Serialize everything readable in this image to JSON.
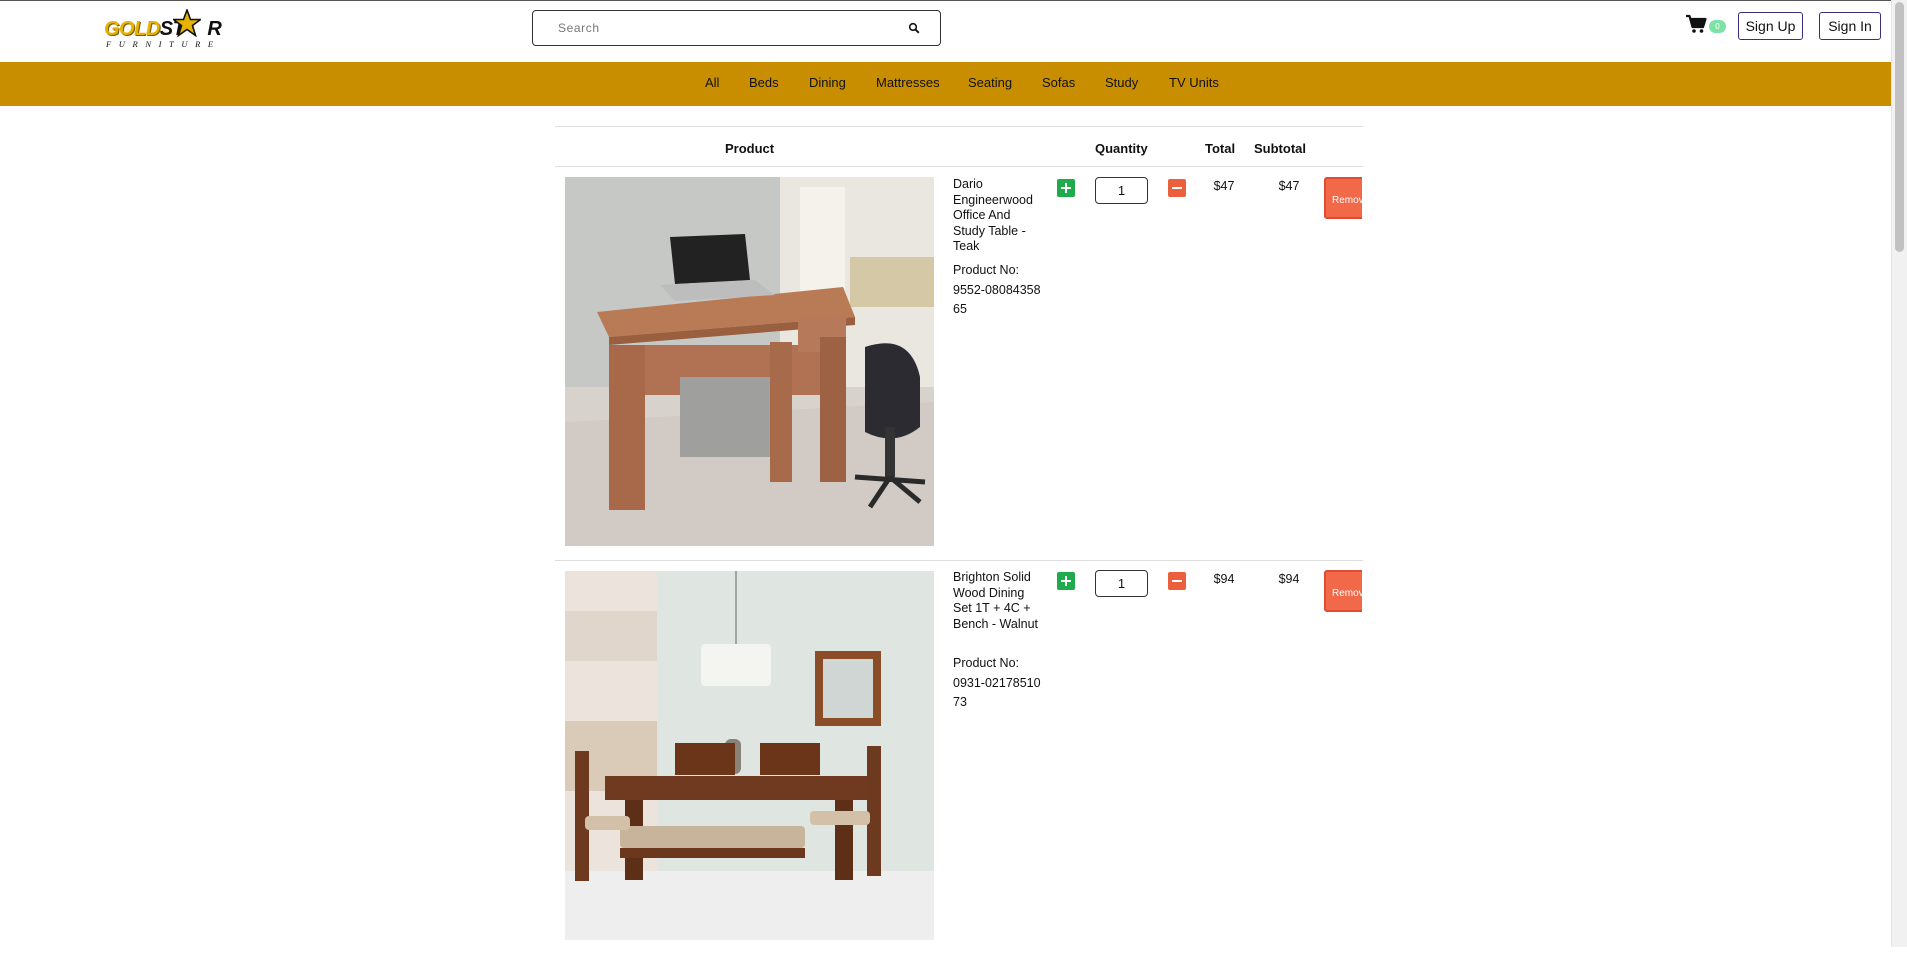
{
  "brand": {
    "logo_word_gold": "GOLD",
    "logo_word_dark": "ST",
    "logo_word_tail": "R",
    "logo_subtitle": "FURNITURE"
  },
  "search": {
    "placeholder": "Search",
    "icon": "search-icon"
  },
  "cart": {
    "icon": "cart-icon",
    "count": "0"
  },
  "auth": {
    "signup": "Sign Up",
    "signin": "Sign In"
  },
  "categories": [
    "All",
    "Beds",
    "Dining",
    "Mattresses",
    "Seating",
    "Sofas",
    "Study",
    "TV Units"
  ],
  "table": {
    "headers": {
      "product": "Product",
      "quantity": "Quantity",
      "total": "Total",
      "subtotal": "Subtotal"
    },
    "rows": [
      {
        "title": "Dario Engineerwood Office And Study Table - Teak",
        "product_no_label": "Product No:",
        "product_no": "9552-0808435865",
        "quantity": "1",
        "total": "$47",
        "subtotal": "$47",
        "remove_label": "Remove all",
        "image": "study-table-photo"
      },
      {
        "title": "Brighton Solid Wood Dining Set 1T + 4C + Bench - Walnut",
        "product_no_label": "Product No:",
        "product_no": "0931-0217851073",
        "quantity": "1",
        "total": "$94",
        "subtotal": "$94",
        "remove_label": "Remove all",
        "image": "dining-set-photo"
      }
    ]
  },
  "colors": {
    "nav_bar": "#c98e00",
    "add_button": "#1faa4c",
    "minus_button": "#ec5f3d",
    "remove_button": "#f2694a",
    "cart_badge": "#7ce2a6"
  }
}
